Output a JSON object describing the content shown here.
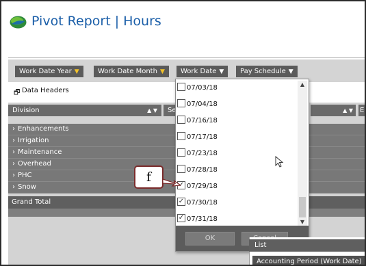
{
  "app": {
    "title": "Pivot Report | Hours"
  },
  "filters": [
    {
      "label": "Work Date Year",
      "icon": "filter-icon",
      "icon_color": "#f2c22a"
    },
    {
      "label": "Work Date Month",
      "icon": "filter-icon",
      "icon_color": "#f2c22a"
    },
    {
      "label": "Work Date",
      "icon": "filter-icon",
      "icon_color": "#ffffff"
    },
    {
      "label": "Pay Schedule",
      "icon": "filter-icon",
      "icon_color": "#ffffff"
    }
  ],
  "data_headers": {
    "label": "Data Headers",
    "icon": "window-icon"
  },
  "columns": {
    "division": "Division",
    "second_partial": "Se",
    "arrows": "▲ ▼",
    "third_partial": "E"
  },
  "rows": [
    {
      "label": "Enhancements"
    },
    {
      "label": "Irrigation"
    },
    {
      "label": "Maintenance"
    },
    {
      "label": "Overhead"
    },
    {
      "label": "PHC"
    },
    {
      "label": "Snow"
    }
  ],
  "grand_total": "Grand Total",
  "dropdown": {
    "items": [
      {
        "label": "07/03/18",
        "checked": false
      },
      {
        "label": "07/04/18",
        "checked": false
      },
      {
        "label": "07/16/18",
        "checked": false
      },
      {
        "label": "07/17/18",
        "checked": false
      },
      {
        "label": "07/23/18",
        "checked": false
      },
      {
        "label": "07/28/18",
        "checked": false
      },
      {
        "label": "07/29/18",
        "checked": true
      },
      {
        "label": "07/30/18",
        "checked": true
      },
      {
        "label": "07/31/18",
        "checked": true
      }
    ],
    "ok_label": "OK",
    "cancel_label": "Cancel"
  },
  "callout": {
    "label": "f"
  },
  "bottom_panel": {
    "header_partial": "List",
    "item": "Accounting Period (Work Date)"
  },
  "colors": {
    "title": "#1a5ea8",
    "chip": "#5b5b5b",
    "row": "#787878",
    "callout_border": "#7a2a2a"
  }
}
